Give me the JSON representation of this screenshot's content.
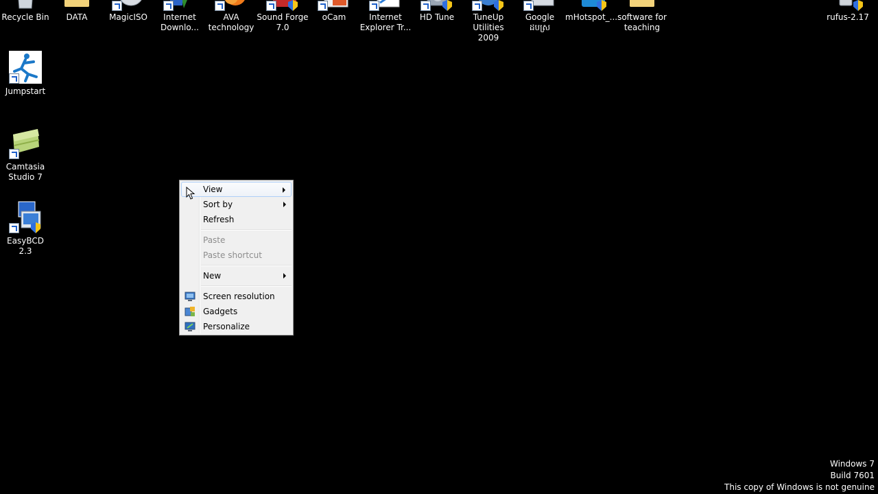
{
  "desktop": {
    "top_icons": [
      {
        "label": "Recycle Bin",
        "icon": "recycle-bin-icon",
        "shortcut": false
      },
      {
        "label": "DATA",
        "icon": "folder-icon",
        "shortcut": false
      },
      {
        "label": "MagicISO",
        "icon": "disc-icon",
        "shortcut": true
      },
      {
        "label": "Internet\nDownlo...",
        "icon": "download-manager-icon",
        "shortcut": true
      },
      {
        "label": "AVA\ntechnology",
        "icon": "app-icon",
        "shortcut": true
      },
      {
        "label": "Sound Forge\n7.0",
        "icon": "audio-editor-icon",
        "shortcut": true
      },
      {
        "label": "oCam",
        "icon": "screen-recorder-icon",
        "shortcut": true
      },
      {
        "label": "Internet\nExplorer Tr...",
        "icon": "browser-icon",
        "shortcut": true
      },
      {
        "label": "HD Tune",
        "icon": "hard-disk-icon",
        "shortcut": true
      },
      {
        "label": "TuneUp\nUtilities 2009",
        "icon": "tuneup-icon",
        "shortcut": true
      },
      {
        "label": "Google\nដបស្រ",
        "icon": "google-icon",
        "shortcut": true
      },
      {
        "label": "mHotspot_...",
        "icon": "wifi-hotspot-icon",
        "shortcut": true
      },
      {
        "label": "software for\nteaching",
        "icon": "folder-icon",
        "shortcut": false
      },
      {
        "label": "rufus-2.17",
        "icon": "usb-drive-icon",
        "shortcut": false
      }
    ],
    "side_icons": [
      {
        "label": "Jumpstart",
        "icon": "jumpstart-icon"
      },
      {
        "label": "Camtasia\nStudio 7",
        "icon": "camtasia-icon"
      },
      {
        "label": "EasyBCD 2.3",
        "icon": "easybcd-icon"
      }
    ]
  },
  "context_menu": {
    "items": [
      {
        "label": "View",
        "submenu": true,
        "disabled": false,
        "hovered": true
      },
      {
        "label": "Sort by",
        "submenu": true,
        "disabled": false
      },
      {
        "label": "Refresh",
        "submenu": false,
        "disabled": false
      },
      {
        "label": "Paste",
        "submenu": false,
        "disabled": true
      },
      {
        "label": "Paste shortcut",
        "submenu": false,
        "disabled": true
      },
      {
        "label": "New",
        "submenu": true,
        "disabled": false
      },
      {
        "label": "Screen resolution",
        "icon": "monitor-icon",
        "disabled": false
      },
      {
        "label": "Gadgets",
        "icon": "gadgets-icon",
        "disabled": false
      },
      {
        "label": "Personalize",
        "icon": "personalize-icon",
        "disabled": false
      }
    ]
  },
  "watermark": {
    "line1": "Windows 7",
    "line2": "Build 7601",
    "line3": "This copy of Windows is not genuine"
  },
  "colors": {
    "desktop_bg": "#000000",
    "menu_bg": "#f0f0f0",
    "menu_hover_border": "#aecff7",
    "disabled_text": "#8d8d8d"
  }
}
